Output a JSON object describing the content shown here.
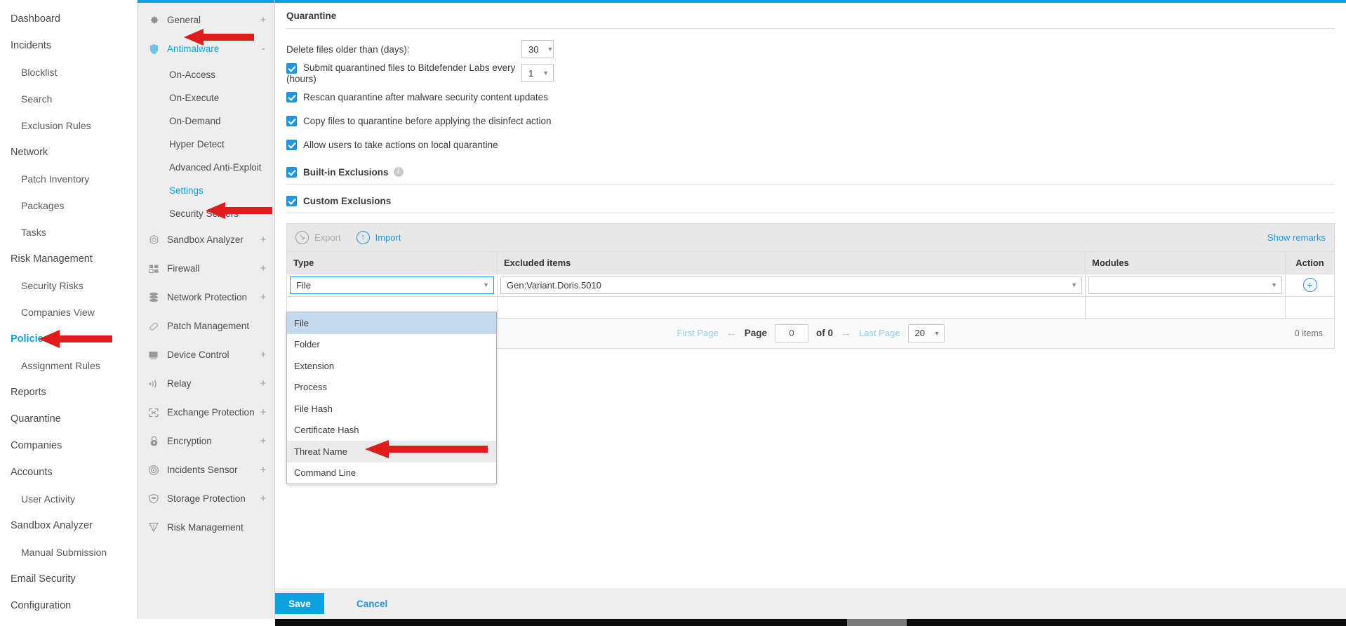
{
  "theme": {
    "accent": "#0aa3e0",
    "link": "#2196e3",
    "checkbox": "#2196e3",
    "sidebar_bg": "#eeeeee",
    "header_bg": "#e8e8e8",
    "annotation": "#e01b1b"
  },
  "main_nav": [
    {
      "label": "Dashboard",
      "level": 0,
      "active": false
    },
    {
      "label": "Incidents",
      "level": 0,
      "active": false
    },
    {
      "label": "Blocklist",
      "level": 1,
      "active": false
    },
    {
      "label": "Search",
      "level": 1,
      "active": false
    },
    {
      "label": "Exclusion Rules",
      "level": 1,
      "active": false
    },
    {
      "label": "Network",
      "level": 0,
      "active": false
    },
    {
      "label": "Patch Inventory",
      "level": 1,
      "active": false
    },
    {
      "label": "Packages",
      "level": 1,
      "active": false
    },
    {
      "label": "Tasks",
      "level": 1,
      "active": false
    },
    {
      "label": "Risk Management",
      "level": 0,
      "active": false
    },
    {
      "label": "Security Risks",
      "level": 1,
      "active": false
    },
    {
      "label": "Companies View",
      "level": 1,
      "active": false
    },
    {
      "label": "Policies",
      "level": 0,
      "active": true
    },
    {
      "label": "Assignment Rules",
      "level": 1,
      "active": false
    },
    {
      "label": "Reports",
      "level": 0,
      "active": false
    },
    {
      "label": "Quarantine",
      "level": 0,
      "active": false
    },
    {
      "label": "Companies",
      "level": 0,
      "active": false
    },
    {
      "label": "Accounts",
      "level": 0,
      "active": false
    },
    {
      "label": "User Activity",
      "level": 1,
      "active": false
    },
    {
      "label": "Sandbox Analyzer",
      "level": 0,
      "active": false
    },
    {
      "label": "Manual Submission",
      "level": 1,
      "active": false
    },
    {
      "label": "Email Security",
      "level": 0,
      "active": false
    },
    {
      "label": "Configuration",
      "level": 0,
      "active": false
    }
  ],
  "policy_nav": [
    {
      "label": "General",
      "icon": "gear-icon",
      "expander": "+",
      "active": false,
      "type": "item"
    },
    {
      "label": "Antimalware",
      "icon": "shield-icon",
      "expander": "-",
      "active": true,
      "type": "item"
    },
    {
      "label": "On-Access",
      "type": "sub",
      "active": false
    },
    {
      "label": "On-Execute",
      "type": "sub",
      "active": false
    },
    {
      "label": "On-Demand",
      "type": "sub",
      "active": false
    },
    {
      "label": "Hyper Detect",
      "type": "sub",
      "active": false
    },
    {
      "label": "Advanced Anti-Exploit",
      "type": "sub",
      "active": false
    },
    {
      "label": "Settings",
      "type": "sub",
      "active": true
    },
    {
      "label": "Security Servers",
      "type": "sub",
      "active": false
    },
    {
      "label": "Sandbox Analyzer",
      "icon": "cube-icon",
      "expander": "+",
      "active": false,
      "type": "item"
    },
    {
      "label": "Firewall",
      "icon": "firewall-icon",
      "expander": "+",
      "active": false,
      "type": "item"
    },
    {
      "label": "Network Protection",
      "icon": "stack-icon",
      "expander": "+",
      "active": false,
      "type": "item"
    },
    {
      "label": "Patch Management",
      "icon": "bandage-icon",
      "expander": "",
      "active": false,
      "type": "item"
    },
    {
      "label": "Device Control",
      "icon": "monitor-icon",
      "expander": "+",
      "active": false,
      "type": "item"
    },
    {
      "label": "Relay",
      "icon": "signal-icon",
      "expander": "+",
      "active": false,
      "type": "item"
    },
    {
      "label": "Exchange Protection",
      "icon": "exchange-icon",
      "expander": "+",
      "active": false,
      "type": "item"
    },
    {
      "label": "Encryption",
      "icon": "lock-icon",
      "expander": "+",
      "active": false,
      "type": "item"
    },
    {
      "label": "Incidents Sensor",
      "icon": "radar-icon",
      "expander": "+",
      "active": false,
      "type": "item"
    },
    {
      "label": "Storage Protection",
      "icon": "storage-shield-icon",
      "expander": "+",
      "active": false,
      "type": "item"
    },
    {
      "label": "Risk Management",
      "icon": "risk-icon",
      "expander": "",
      "active": false,
      "type": "item"
    }
  ],
  "quarantine": {
    "title": "Quarantine",
    "delete_older_label": "Delete files older than (days):",
    "delete_older_value": "30",
    "options": [
      {
        "label": "Submit quarantined files to Bitdefender Labs every (hours)",
        "checked": true,
        "has_select": true,
        "select_value": "1"
      },
      {
        "label": "Rescan quarantine after malware security content updates",
        "checked": true,
        "has_select": false
      },
      {
        "label": "Copy files to quarantine before applying the disinfect action",
        "checked": true,
        "has_select": false
      },
      {
        "label": "Allow users to take actions on local quarantine",
        "checked": true,
        "has_select": false
      }
    ]
  },
  "exclusions": {
    "builtin_label": "Built-in Exclusions",
    "builtin_checked": true,
    "custom_label": "Custom Exclusions",
    "custom_checked": true,
    "toolbar": {
      "export_label": "Export",
      "export_icon": "export-icon",
      "import_label": "Import",
      "import_icon": "import-icon",
      "show_remarks_label": "Show remarks"
    },
    "table": {
      "headers": [
        "Type",
        "Excluded items",
        "Modules",
        "Action"
      ],
      "row": {
        "type_value": "File",
        "excluded_items_value": "Gen:Variant.Doris.5010",
        "modules_value": "",
        "action_icon": "add-circle-icon"
      }
    },
    "type_dropdown": {
      "open": true,
      "options": [
        {
          "label": "File",
          "selected": true,
          "hovered": false
        },
        {
          "label": "Folder",
          "selected": false,
          "hovered": false
        },
        {
          "label": "Extension",
          "selected": false,
          "hovered": false
        },
        {
          "label": "Process",
          "selected": false,
          "hovered": false
        },
        {
          "label": "File Hash",
          "selected": false,
          "hovered": false
        },
        {
          "label": "Certificate Hash",
          "selected": false,
          "hovered": false
        },
        {
          "label": "Threat Name",
          "selected": false,
          "hovered": true
        },
        {
          "label": "Command Line",
          "selected": false,
          "hovered": false
        }
      ]
    },
    "pagination": {
      "first_page": "First Page",
      "prev_arrow": "←",
      "page_label": "Page",
      "page_value": "0",
      "of_label": "of 0",
      "next_arrow": "→",
      "last_page": "Last Page",
      "page_size": "20",
      "items_count": "0 items"
    }
  },
  "footer": {
    "save_label": "Save",
    "cancel_label": "Cancel"
  }
}
